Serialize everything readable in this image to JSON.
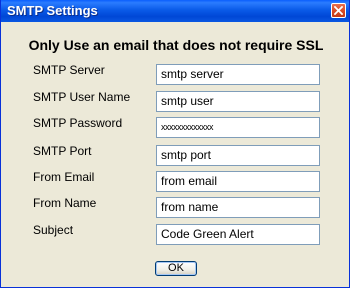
{
  "window": {
    "title": "SMTP Settings"
  },
  "heading": "Only Use an email that does not require SSL",
  "fields": [
    {
      "label": "SMTP Server",
      "value": "smtp server"
    },
    {
      "label": "SMTP User Name",
      "value": "smtp user"
    },
    {
      "label": "SMTP Password",
      "value": "xxxxxxxxxxxxx"
    },
    {
      "label": "SMTP Port",
      "value": "smtp port"
    },
    {
      "label": "From Email",
      "value": "from email"
    },
    {
      "label": "From Name",
      "value": "from name"
    },
    {
      "label": "Subject",
      "value": "Code Green Alert"
    }
  ],
  "buttons": {
    "ok_label": "OK"
  },
  "icons": {
    "close": "close-icon"
  },
  "colors": {
    "titlebar": "#0a5be8",
    "dialog_background": "#ece9d8",
    "close_button": "#d94a25"
  }
}
